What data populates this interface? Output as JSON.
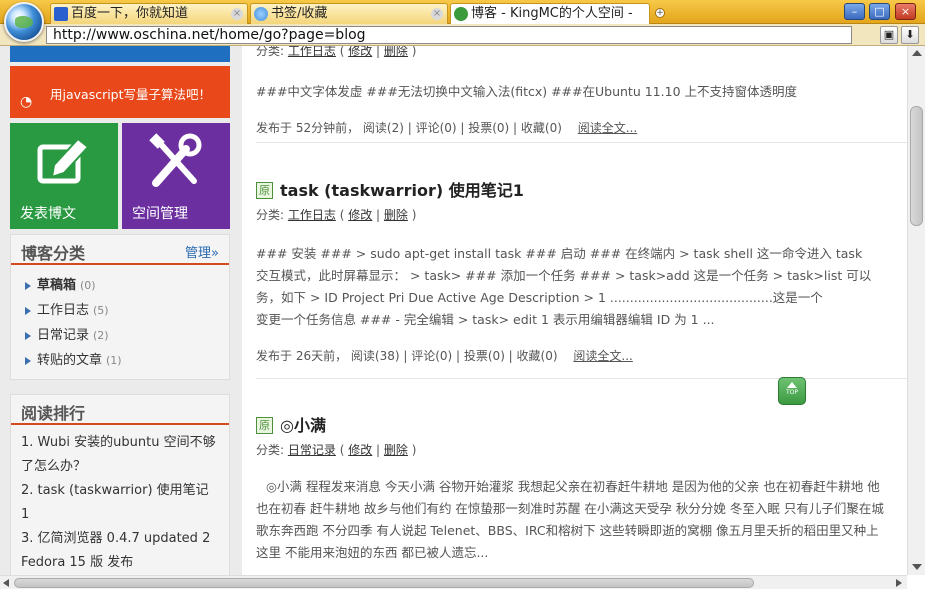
{
  "browser": {
    "tabs": [
      {
        "label": "百度一下，你就知道",
        "icon": "paw-icon",
        "color": "#2a5fd0"
      },
      {
        "label": "书签/收藏",
        "icon": "globe-icon",
        "color": "#3c8dde"
      },
      {
        "label": "博客 - KingMC的个人空间 -",
        "icon": "refresh-icon",
        "color": "#3a9a3c"
      }
    ],
    "address": "http://www.oschina.net/home/go?page=blog"
  },
  "sidebar": {
    "tiles": {
      "quantum_label": "用javascript写量子算法吧！",
      "post_label": "发表博文",
      "manage_label": "空间管理"
    },
    "categories": {
      "title": "博客分类",
      "manage": "管理»",
      "items": [
        {
          "name": "草稿箱",
          "count": "(0)",
          "bold": true
        },
        {
          "name": "工作日志",
          "count": "(5)"
        },
        {
          "name": "日常记录",
          "count": "(2)"
        },
        {
          "name": "转贴的文章",
          "count": "(1)"
        }
      ]
    },
    "ranking": {
      "title": "阅读排行",
      "lines": [
        "1. Wubi 安装的ubuntu 空间不够",
        "了怎么办？",
        "2. task (taskwarrior) 使用笔记",
        "1",
        "3. 亿简浏览器 0.4.7 updated 2",
        "Fedora 15 版 发布"
      ]
    }
  },
  "posts": [
    {
      "meta": {
        "prefix": "分类:",
        "category": "工作日志",
        "edit": "修改",
        "delete": "删除",
        "sep": "|"
      },
      "summary": "###中文字体发虚 ###无法切换中文输入法(fitcx) ###在Ubuntu 11.10 上不支持窗体透明度",
      "footer": "发布于 52分钟前， 阅读(2) | 评论(0) | 投票(0) | 收藏(0)",
      "read_more": "阅读全文..."
    },
    {
      "badge": "原",
      "title": "task (taskwarrior) 使用笔记1",
      "meta": {
        "prefix": "分类:",
        "category": "工作日志",
        "edit": "修改",
        "delete": "删除",
        "sep": "|"
      },
      "summary_lines": [
        "### 安装 ### > sudo apt-get install task ### 启动 ### 在终端内 > task shell 这一命令进入 task",
        "交互模式，此时屏幕显示： > task> ### 添加一个任务 ### > task>add 这是一个任务 > task>list 可以",
        "务，如下 > ID Project Pri Due Active Age Description > 1 .........................................这是一个",
        "变更一个任务信息 ### - 完全编辑 > task> edit 1 表示用编辑器编辑 ID 为 1 ..."
      ],
      "footer": "发布于 26天前， 阅读(38) | 评论(0) | 投票(0) | 收藏(0)",
      "read_more": "阅读全文..."
    },
    {
      "badge": "原",
      "title": "◎小满",
      "meta": {
        "prefix": "分类:",
        "category": "日常记录",
        "edit": "修改",
        "delete": "删除",
        "sep": "|"
      },
      "summary_lines": [
        "◎小满 程程发来消息 今天小满 谷物开始灌浆 我想起父亲在初春赶牛耕地 是因为他的父亲 也在初春赶牛耕地 他",
        "也在初春 赶牛耕地 故乡与他们有约 在惊蛰那一刻准时苏醒 在小满这天受孕 秋分分娩 冬至入眠 只有儿子们聚在城",
        "歌东奔西跑 不分四季 有人说起 Telenet、BBS、IRC和榕树下 这些转瞬即逝的窝棚 像五月里夭折的稻田里又种上",
        "这里 不能用来泡妞的东西 都已被人遗忘..."
      ]
    }
  ],
  "top_button": "TOP"
}
